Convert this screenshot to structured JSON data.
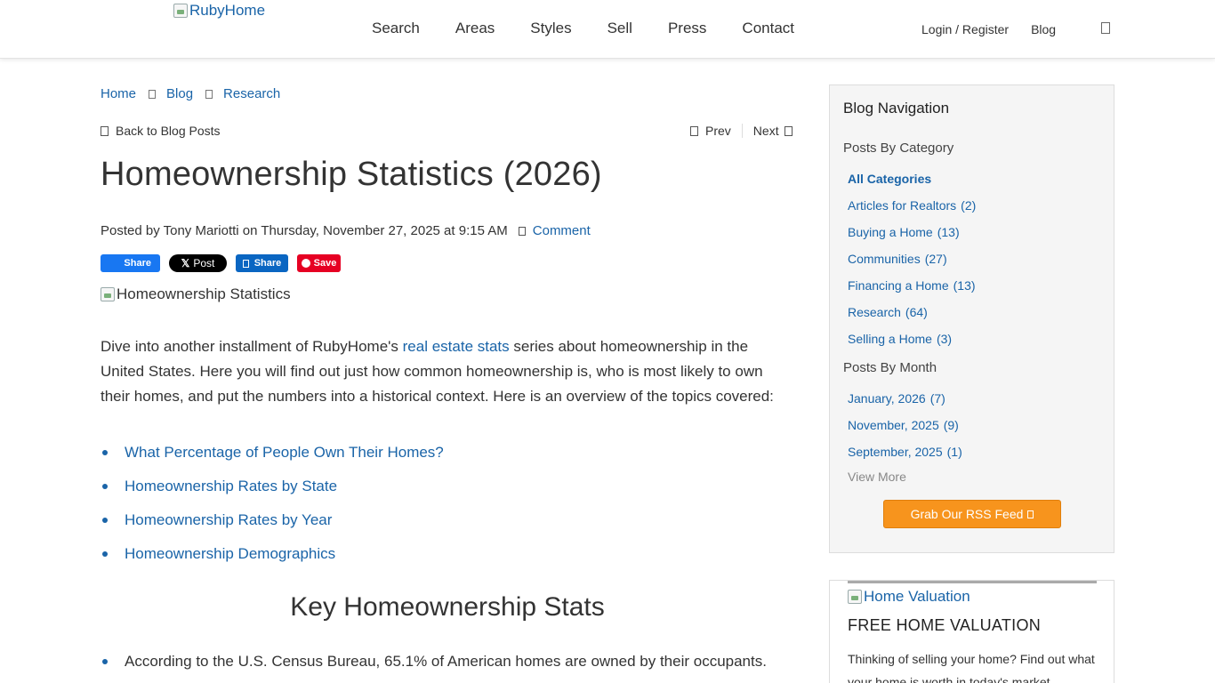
{
  "header": {
    "logo_alt": "RubyHome",
    "nav": [
      "Search",
      "Areas",
      "Styles",
      "Sell",
      "Press",
      "Contact"
    ],
    "login": "Login / Register",
    "blog": "Blog"
  },
  "breadcrumb": [
    "Home",
    "Blog",
    "Research"
  ],
  "post_nav": {
    "back": "Back to Blog Posts",
    "prev": "Prev",
    "next": "Next"
  },
  "post": {
    "title": "Homeownership Statistics (2026)",
    "meta_prefix": "Posted by Tony Mariotti on Thursday, November 27, 2025 at 9:15 AM",
    "comment": "Comment",
    "hero_alt": "Homeownership Statistics",
    "intro_before": "Dive into another installment of RubyHome's ",
    "intro_link": "real estate stats",
    "intro_after": " series about homeownership in the United States. Here you will find out just how common homeownership is, who is most likely to own their homes, and put the numbers into a historical context. Here is an overview of the topics covered:",
    "toc": [
      "What Percentage of People Own Their Homes?",
      "Homeownership Rates by State",
      "Homeownership Rates by Year",
      "Homeownership Demographics"
    ],
    "section_heading": "Key Homeownership Stats",
    "key_stats": [
      "According to the U.S. Census Bureau, 65.1% of American homes are owned by their occupants."
    ]
  },
  "share": {
    "facebook": "Share",
    "x": "Post",
    "linkedin": "Share",
    "pinterest": "Save"
  },
  "sidebar": {
    "title": "Blog Navigation",
    "by_category_label": "Posts By Category",
    "categories": [
      {
        "label": "All Categories",
        "count": ""
      },
      {
        "label": "Articles for Realtors",
        "count": "(2)"
      },
      {
        "label": "Buying a Home",
        "count": "(13)"
      },
      {
        "label": "Communities",
        "count": "(27)"
      },
      {
        "label": "Financing a Home",
        "count": "(13)"
      },
      {
        "label": "Research",
        "count": "(64)"
      },
      {
        "label": "Selling a Home",
        "count": "(3)"
      }
    ],
    "by_month_label": "Posts By Month",
    "months": [
      {
        "label": "January, 2026",
        "count": "(7)"
      },
      {
        "label": "November, 2025",
        "count": "(9)"
      },
      {
        "label": "September, 2025",
        "count": "(1)"
      }
    ],
    "view_more": "View More",
    "rss": "Grab Our RSS Feed"
  },
  "valuation": {
    "img_alt": "Home Valuation",
    "title": "FREE HOME VALUATION",
    "text": "Thinking of selling your home? Find out what your home is worth in today's market."
  }
}
